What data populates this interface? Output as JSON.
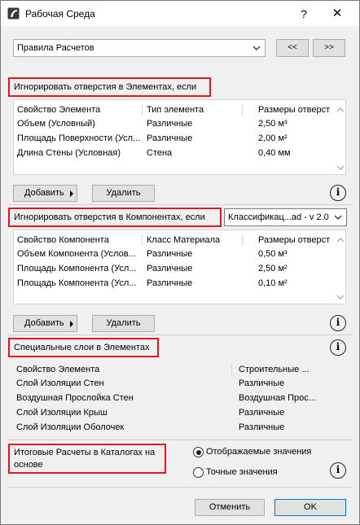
{
  "window": {
    "title": "Рабочая Среда",
    "help_glyph": "?",
    "close_glyph": "✕"
  },
  "top": {
    "dropdown_value": "Правила Расчетов",
    "prev_label": "<<",
    "next_label": ">>"
  },
  "section1": {
    "heading": "Игнорировать отверстия в Элементах, если",
    "columns": [
      "Свойство Элемента",
      "Тип элемента",
      "Размеры отверст"
    ],
    "rows": [
      [
        "Объем (Условный)",
        "Различные",
        "2,50 м³"
      ],
      [
        "Площадь Поверхности (Усл...",
        "Различные",
        "2,00 м²"
      ],
      [
        "Длина Стены (Условная)",
        "Стена",
        "0,40 мм"
      ]
    ],
    "add_label": "Добавить",
    "delete_label": "Удалить",
    "info_glyph": "i"
  },
  "section2": {
    "heading": "Игнорировать отверстия в Компонентах, если",
    "classification_value": "Классификац...ad - v 2.0",
    "columns": [
      "Свойство Компонента",
      "Класс Материала",
      "Размеры отверст"
    ],
    "rows": [
      [
        "Объем Компонента (Услов...",
        "Различные",
        "0,50 м³"
      ],
      [
        "Площадь Компонента (Усл...",
        "Различные",
        "2,50 м²"
      ],
      [
        "Площадь Компонента (Усл...",
        "Различные",
        "0,10 м²"
      ]
    ],
    "add_label": "Добавить",
    "delete_label": "Удалить",
    "info_glyph": "i"
  },
  "section3": {
    "heading": "Специальные слои в Элементах",
    "columns": [
      "Свойство Элемента",
      "Строительные ..."
    ],
    "rows": [
      [
        "Слой Изоляции Стен",
        "Различные"
      ],
      [
        "Воздушная Прослойка Стен",
        "Воздушная Прос..."
      ],
      [
        "Слой Изоляции Крыш",
        "Различные"
      ],
      [
        "Слой Изоляции Оболочек",
        "Различные"
      ]
    ],
    "info_glyph": "i"
  },
  "section4": {
    "heading_line1": "Итоговые Расчеты в Каталогах на",
    "heading_line2": "основе",
    "radio_displayed": "Отображаемые значения",
    "radio_exact": "Точные значения",
    "selected": "Отображаемые значения",
    "info_glyph": "i"
  },
  "footer": {
    "cancel_label": "Отменить",
    "ok_label": "OK"
  },
  "colors": {
    "highlight_border": "#e8141d",
    "focus_border": "#0078d7",
    "dialog_bg": "#f0f0f0"
  },
  "icons": [
    "app-icon",
    "help-icon",
    "close-icon",
    "chevron-down-icon",
    "triangle-right-icon",
    "info-icon",
    "scroll-up-icon",
    "scroll-down-icon"
  ]
}
